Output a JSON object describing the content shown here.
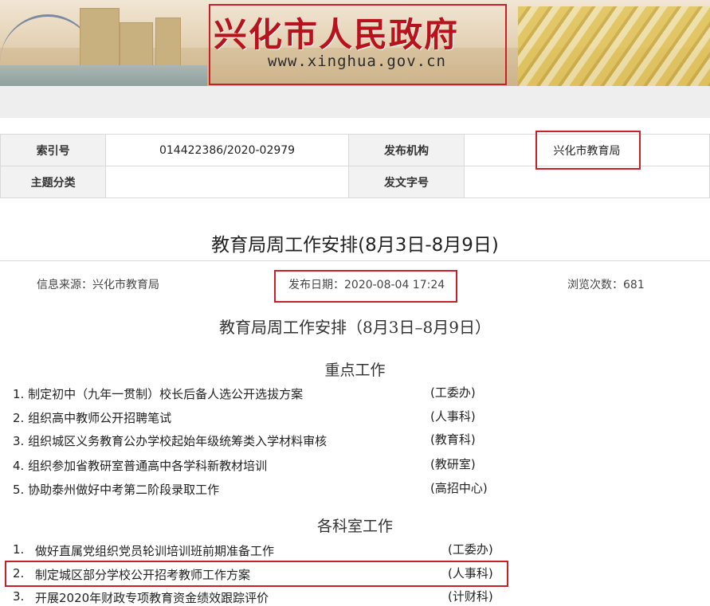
{
  "banner": {
    "title": "兴化市人民政府",
    "url": "www.xinghua.gov.cn"
  },
  "meta": {
    "index_label": "索引号",
    "index_value": "014422386/2020-02979",
    "publisher_label": "发布机构",
    "publisher_value": "兴化市教育局",
    "category_label": "主题分类",
    "category_value": "",
    "docno_label": "发文字号",
    "docno_value": ""
  },
  "article": {
    "title": "教育局周工作安排(8月3日-8月9日)",
    "source": "信息来源：兴化市教育局",
    "date": "发布日期：2020-08-04 17:24",
    "views": "浏览次数：681",
    "subtitle": "教育局周工作安排（8月3日–8月9日）"
  },
  "key_work": {
    "heading": "重点工作",
    "items": [
      {
        "text": "1. 制定初中（九年一贯制）校长后备人选公开选拔方案",
        "dept": "(工委办)"
      },
      {
        "text": "2. 组织高中教师公开招聘笔试",
        "dept": "(人事科)"
      },
      {
        "text": "3. 组织城区义务教育公办学校起始年级统筹类入学材料审核",
        "dept": "(教育科)"
      },
      {
        "text": "4. 组织参加省教研室普通高中各学科新教材培训",
        "dept": "(教研室)"
      },
      {
        "text": "5. 协助泰州做好中考第二阶段录取工作",
        "dept": "(高招中心)"
      }
    ]
  },
  "dept_work": {
    "heading": "各科室工作",
    "items": [
      {
        "num": "1.",
        "text": "做好直属党组织党员轮训培训班前期准备工作",
        "dept": "(工委办)"
      },
      {
        "num": "2.",
        "text": "制定城区部分学校公开招考教师工作方案",
        "dept": "(人事科)"
      },
      {
        "num": "3.",
        "text": "开展2020年财政专项教育资金绩效跟踪评价",
        "dept": "(计财科)"
      }
    ]
  }
}
